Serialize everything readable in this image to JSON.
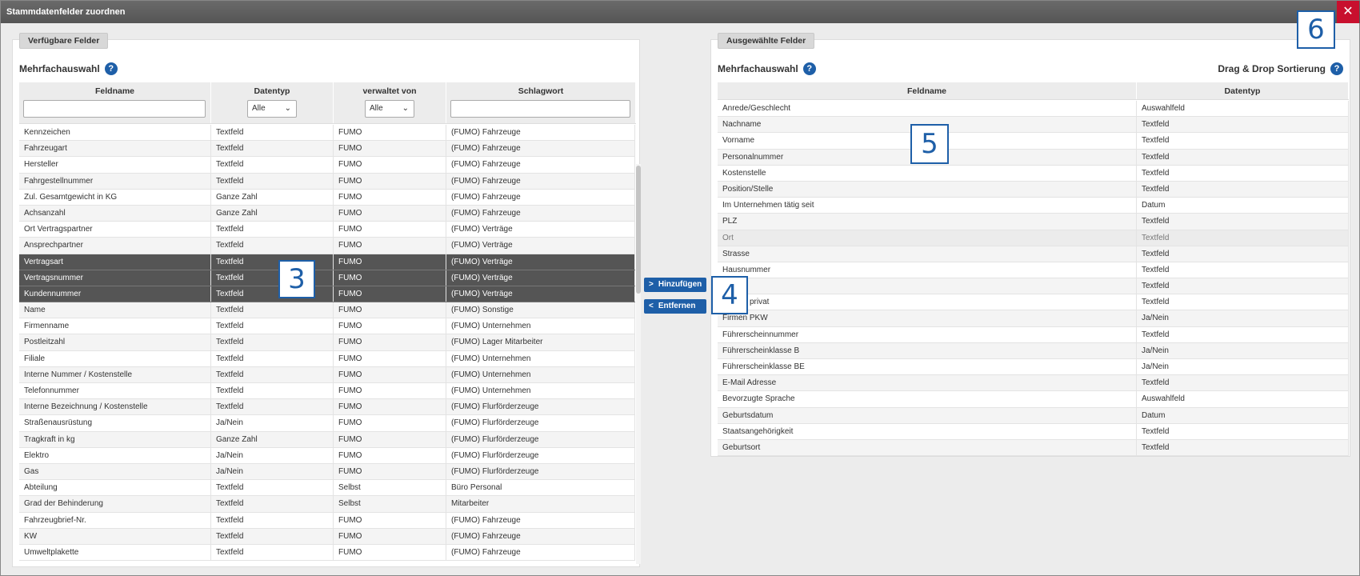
{
  "title": "Stammdatenfelder zuordnen",
  "close_symbol": "✕",
  "left": {
    "tab": "Verfügbare Felder",
    "mehrfach": "Mehrfachauswahl",
    "help": "?",
    "headers": [
      "Feldname",
      "Datentyp",
      "verwaltet von",
      "Schlagwort"
    ],
    "filter_datentyp": "Alle",
    "filter_verwaltet": "Alle",
    "rows": [
      [
        "Kennzeichen",
        "Textfeld",
        "FUMO",
        "(FUMO) Fahrzeuge"
      ],
      [
        "Fahrzeugart",
        "Textfeld",
        "FUMO",
        "(FUMO) Fahrzeuge"
      ],
      [
        "Hersteller",
        "Textfeld",
        "FUMO",
        "(FUMO) Fahrzeuge"
      ],
      [
        "Fahrgestellnummer",
        "Textfeld",
        "FUMO",
        "(FUMO) Fahrzeuge"
      ],
      [
        "Zul. Gesamtgewicht in KG",
        "Ganze Zahl",
        "FUMO",
        "(FUMO) Fahrzeuge"
      ],
      [
        "Achsanzahl",
        "Ganze Zahl",
        "FUMO",
        "(FUMO) Fahrzeuge"
      ],
      [
        "Ort Vertragspartner",
        "Textfeld",
        "FUMO",
        "(FUMO) Verträge"
      ],
      [
        "Ansprechpartner",
        "Textfeld",
        "FUMO",
        "(FUMO) Verträge"
      ],
      [
        "Vertragsart",
        "Textfeld",
        "FUMO",
        "(FUMO) Verträge"
      ],
      [
        "Vertragsnummer",
        "Textfeld",
        "FUMO",
        "(FUMO) Verträge"
      ],
      [
        "Kundennummer",
        "Textfeld",
        "FUMO",
        "(FUMO) Verträge"
      ],
      [
        "Name",
        "Textfeld",
        "FUMO",
        "(FUMO) Sonstige"
      ],
      [
        "Firmenname",
        "Textfeld",
        "FUMO",
        "(FUMO) Unternehmen"
      ],
      [
        "Postleitzahl",
        "Textfeld",
        "FUMO",
        "(FUMO) Lager Mitarbeiter"
      ],
      [
        "Filiale",
        "Textfeld",
        "FUMO",
        "(FUMO) Unternehmen"
      ],
      [
        "Interne Nummer / Kostenstelle",
        "Textfeld",
        "FUMO",
        "(FUMO) Unternehmen"
      ],
      [
        "Telefonnummer",
        "Textfeld",
        "FUMO",
        "(FUMO) Unternehmen"
      ],
      [
        "Interne Bezeichnung / Kostenstelle",
        "Textfeld",
        "FUMO",
        "(FUMO) Flurförderzeuge"
      ],
      [
        "Straßenausrüstung",
        "Ja/Nein",
        "FUMO",
        "(FUMO) Flurförderzeuge"
      ],
      [
        "Tragkraft in kg",
        "Ganze Zahl",
        "FUMO",
        "(FUMO) Flurförderzeuge"
      ],
      [
        "Elektro",
        "Ja/Nein",
        "FUMO",
        "(FUMO) Flurförderzeuge"
      ],
      [
        "Gas",
        "Ja/Nein",
        "FUMO",
        "(FUMO) Flurförderzeuge"
      ],
      [
        "Abteilung",
        "Textfeld",
        "Selbst",
        "Büro Personal"
      ],
      [
        "Grad der Behinderung",
        "Textfeld",
        "Selbst",
        "Mitarbeiter"
      ],
      [
        "Fahrzeugbrief-Nr.",
        "Textfeld",
        "FUMO",
        "(FUMO) Fahrzeuge"
      ],
      [
        "KW",
        "Textfeld",
        "FUMO",
        "(FUMO) Fahrzeuge"
      ],
      [
        "Umweltplakette",
        "Textfeld",
        "FUMO",
        "(FUMO) Fahrzeuge"
      ]
    ]
  },
  "right": {
    "tab": "Ausgewählte Felder",
    "mehrfach": "Mehrfachauswahl",
    "help": "?",
    "dnd": "Drag & Drop Sortierung",
    "headers": [
      "Feldname",
      "Datentyp"
    ],
    "rows": [
      [
        "Anrede/Geschlecht",
        "Auswahlfeld"
      ],
      [
        "Nachname",
        "Textfeld"
      ],
      [
        "Vorname",
        "Textfeld"
      ],
      [
        "Personalnummer",
        "Textfeld"
      ],
      [
        "Kostenstelle",
        "Textfeld"
      ],
      [
        "Position/Stelle",
        "Textfeld"
      ],
      [
        "Im Unternehmen tätig seit",
        "Datum"
      ],
      [
        "PLZ",
        "Textfeld"
      ],
      [
        "Ort",
        "Textfeld"
      ],
      [
        "Strasse",
        "Textfeld"
      ],
      [
        "Hausnummer",
        "Textfeld"
      ],
      [
        "",
        "Textfeld"
      ],
      [
        "privat",
        "Textfeld"
      ],
      [
        "Firmen PKW",
        "Ja/Nein"
      ],
      [
        "Führerscheinnummer",
        "Textfeld"
      ],
      [
        "Führerscheinklasse B",
        "Ja/Nein"
      ],
      [
        "Führerscheinklasse BE",
        "Ja/Nein"
      ],
      [
        "E-Mail Adresse",
        "Textfeld"
      ],
      [
        "Bevorzugte Sprache",
        "Auswahlfeld"
      ],
      [
        "Geburtsdatum",
        "Datum"
      ],
      [
        "Staatsangehörigkeit",
        "Textfeld"
      ],
      [
        "Geburtsort",
        "Textfeld"
      ]
    ]
  },
  "buttons": {
    "add": "Hinzufügen",
    "remove": "Entfernen"
  },
  "callouts": [
    "3",
    "4",
    "5",
    "6"
  ]
}
